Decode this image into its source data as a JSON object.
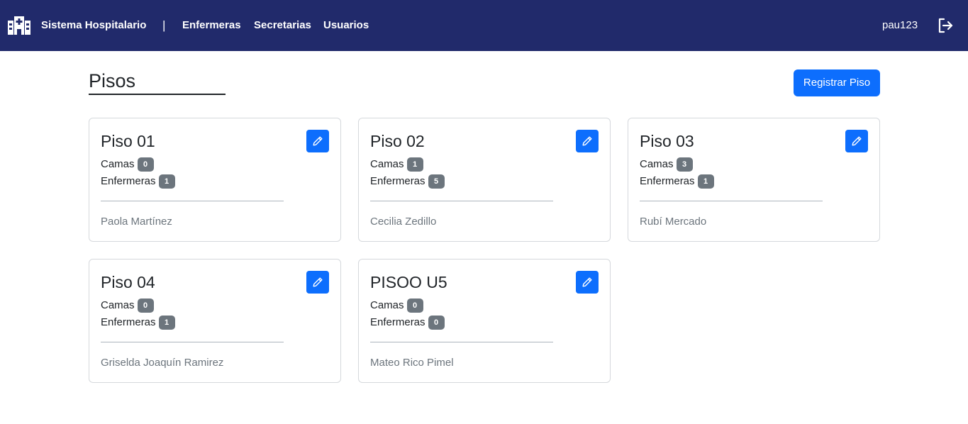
{
  "navbar": {
    "brand_icon": "hospital-icon",
    "brand_title": "Sistema Hospitalario",
    "separator": "|",
    "links": [
      "Enfermeras",
      "Secretarias",
      "Usuarios"
    ],
    "user_name": "pau123",
    "logout_icon": "logout-icon",
    "background_color": "#212a6b"
  },
  "page": {
    "title": "Pisos",
    "register_button_label": "Registrar Piso",
    "accent_color": "#0d6efd"
  },
  "labels": {
    "beds": "Camas",
    "nurses": "Enfermeras"
  },
  "floors": [
    {
      "name": "Piso 01",
      "beds": "0",
      "nurses": "1",
      "person": "Paola Martínez"
    },
    {
      "name": "Piso 02",
      "beds": "1",
      "nurses": "5",
      "person": "Cecilia Zedillo"
    },
    {
      "name": "Piso 03",
      "beds": "3",
      "nurses": "1",
      "person": "Rubí Mercado"
    },
    {
      "name": "Piso 04",
      "beds": "0",
      "nurses": "1",
      "person": "Griselda Joaquín Ramirez"
    },
    {
      "name": "PISOO U5",
      "beds": "0",
      "nurses": "0",
      "person": "Mateo Rico Pimel"
    }
  ]
}
